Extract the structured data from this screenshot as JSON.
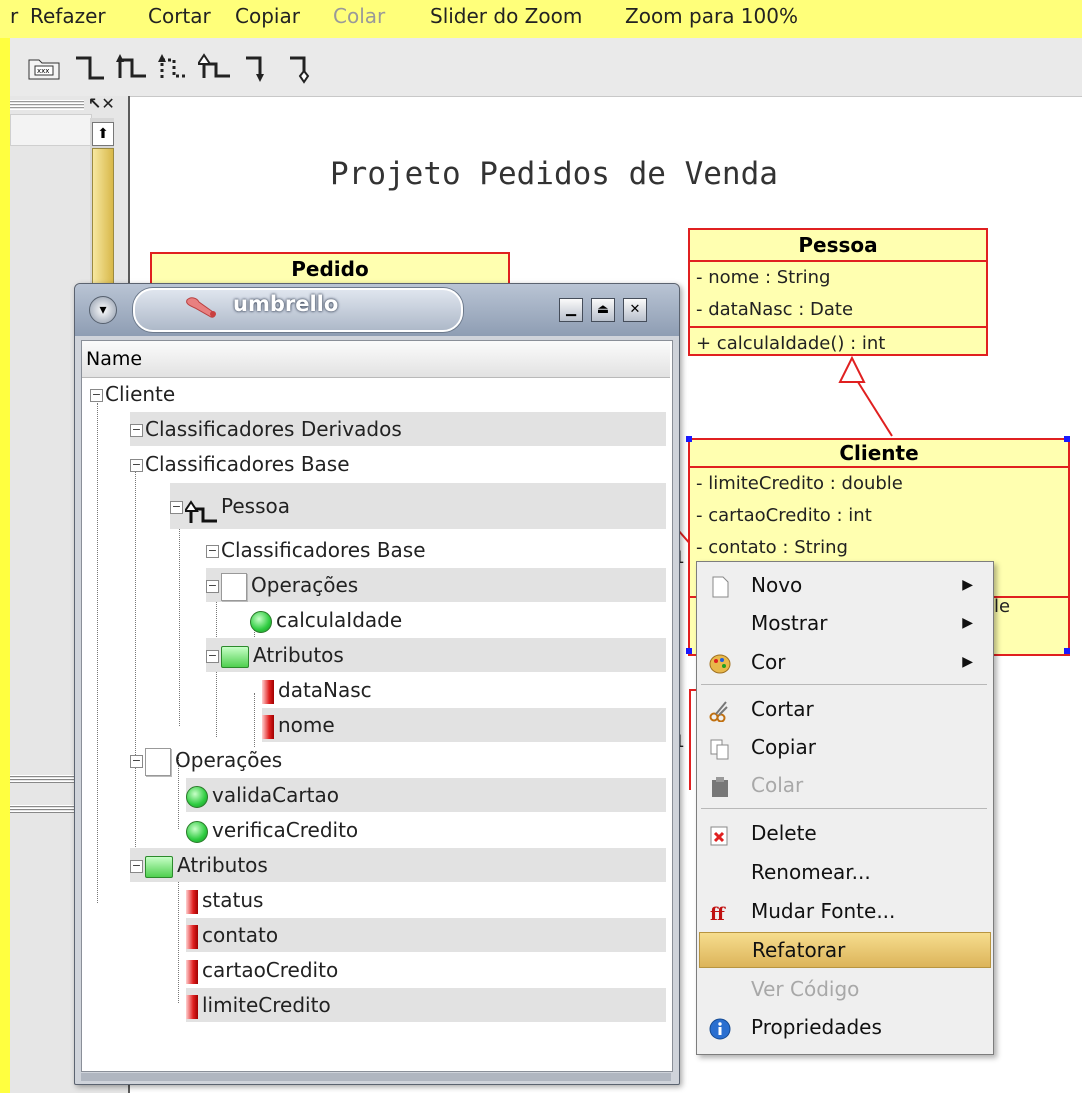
{
  "menubar": [
    "r",
    "Refazer",
    "Cortar",
    "Copiar",
    "Colar",
    "Slider do Zoom",
    "Zoom para 100%"
  ],
  "toolbar": {
    "icons": [
      "class-box-icon",
      "association-icon",
      "generalization-icon",
      "dependency-icon",
      "realization-icon",
      "composition-icon",
      "aggregation-icon"
    ]
  },
  "dock": {
    "float_label": "↖✕",
    "scroll_up": "⬆"
  },
  "diagram": {
    "title": "Projeto Pedidos de Venda",
    "pedido": {
      "name": "Pedido"
    },
    "pessoa": {
      "name": "Pessoa",
      "attributes": [
        "- nome : String",
        "- dataNasc : Date"
      ],
      "operations": [
        "+ calculaIdade() : int"
      ]
    },
    "cliente": {
      "name": "Cliente",
      "attributes": [
        "- limiteCredito : double",
        "- cartaoCredito : int",
        "- contato : String"
      ],
      "partial": "le"
    },
    "multiplicity": [
      "1",
      "1"
    ]
  },
  "umbrello": {
    "title": "umbrello",
    "column": "Name",
    "tree": [
      {
        "label": "Cliente",
        "icon": "none"
      },
      {
        "label": "Classificadores Derivados",
        "icon": "none"
      },
      {
        "label": "Classificadores Base",
        "icon": "none"
      },
      {
        "label": "Pessoa",
        "icon": "generalization"
      },
      {
        "label": "Classificadores Base",
        "icon": "none"
      },
      {
        "label": "Operações",
        "icon": "doc"
      },
      {
        "label": "calculaIdade",
        "icon": "green"
      },
      {
        "label": "Atributos",
        "icon": "folder"
      },
      {
        "label": "dataNasc",
        "icon": "red"
      },
      {
        "label": "nome",
        "icon": "red"
      },
      {
        "label": "Operações",
        "icon": "doc"
      },
      {
        "label": "validaCartao",
        "icon": "green"
      },
      {
        "label": "verificaCredito",
        "icon": "green"
      },
      {
        "label": "Atributos",
        "icon": "folder"
      },
      {
        "label": "status",
        "icon": "red"
      },
      {
        "label": "contato",
        "icon": "red"
      },
      {
        "label": "cartaoCredito",
        "icon": "red"
      },
      {
        "label": "limiteCredito",
        "icon": "red"
      }
    ]
  },
  "context_menu": {
    "items": [
      {
        "label": "Novo",
        "submenu": true,
        "icon": "new-doc-icon"
      },
      {
        "label": "Mostrar",
        "submenu": true
      },
      {
        "label": "Cor",
        "submenu": true,
        "icon": "palette-icon"
      },
      {
        "label": "Cortar",
        "icon": "scissors-icon"
      },
      {
        "label": "Copiar",
        "icon": "copy-icon"
      },
      {
        "label": "Colar",
        "disabled": true,
        "icon": "paste-icon"
      },
      {
        "label": "Delete",
        "icon": "delete-icon"
      },
      {
        "label": "Renomear..."
      },
      {
        "label": "Mudar Fonte...",
        "icon": "font-icon"
      },
      {
        "label": "Refatorar",
        "selected": true
      },
      {
        "label": "Ver Código",
        "disabled": true
      },
      {
        "label": "Propriedades",
        "icon": "info-icon"
      }
    ]
  },
  "colors": {
    "accent_yellow": "#ffff40",
    "uml_border": "#e02020",
    "uml_fill": "#ffffb0",
    "menu_highlight": "#dcb45a"
  }
}
